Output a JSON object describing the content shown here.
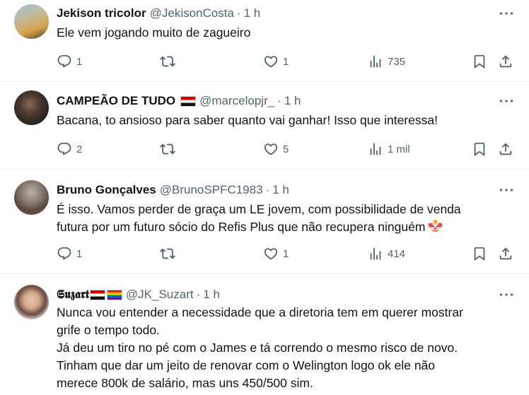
{
  "colors": {
    "text": "#0f1419",
    "muted": "#536471",
    "divider": "#eff3f4"
  },
  "tweets": [
    {
      "name": "Jekison tricolor",
      "handle": "@JekisonCosta",
      "time": "1 h",
      "text": [
        "Ele vem jogando muito de zagueiro"
      ],
      "replies": "1",
      "reposts": "",
      "likes": "1",
      "views": "735"
    },
    {
      "name": "CAMPEÃO DE TUDO",
      "handle": "@marcelopjr_",
      "time": "1 h",
      "text": [
        "Bacana, to ansioso para saber quanto vai ganhar! Isso que interessa!"
      ],
      "replies": "2",
      "reposts": "",
      "likes": "5",
      "views": "1 mil"
    },
    {
      "name": "Bruno Gonçalves",
      "handle": "@BrunoSPFC1983",
      "time": "1 h",
      "text": [
        "É isso. Vamos perder de graça um LE jovem, com possibilidade de venda",
        "futura por um futuro sócio do Refis Plus que não recupera ninguém"
      ],
      "replies": "1",
      "reposts": "",
      "likes": "1",
      "views": "414"
    },
    {
      "name": "𝕾𝖚𝖟𝖆𝖗𝖙",
      "handle": "@JK_Suzart",
      "time": "1 h",
      "text": [
        "Nunca vou entender a necessidade que a diretoria tem em querer mostrar",
        "grife o tempo todo.",
        "Já deu um tiro no pé com o James e tá correndo o mesmo risco de novo.",
        "Tinham que dar um jeito de renovar com o Welington logo ok ele não",
        "merece 800k de salário, mas uns 450/500 sim."
      ]
    }
  ]
}
